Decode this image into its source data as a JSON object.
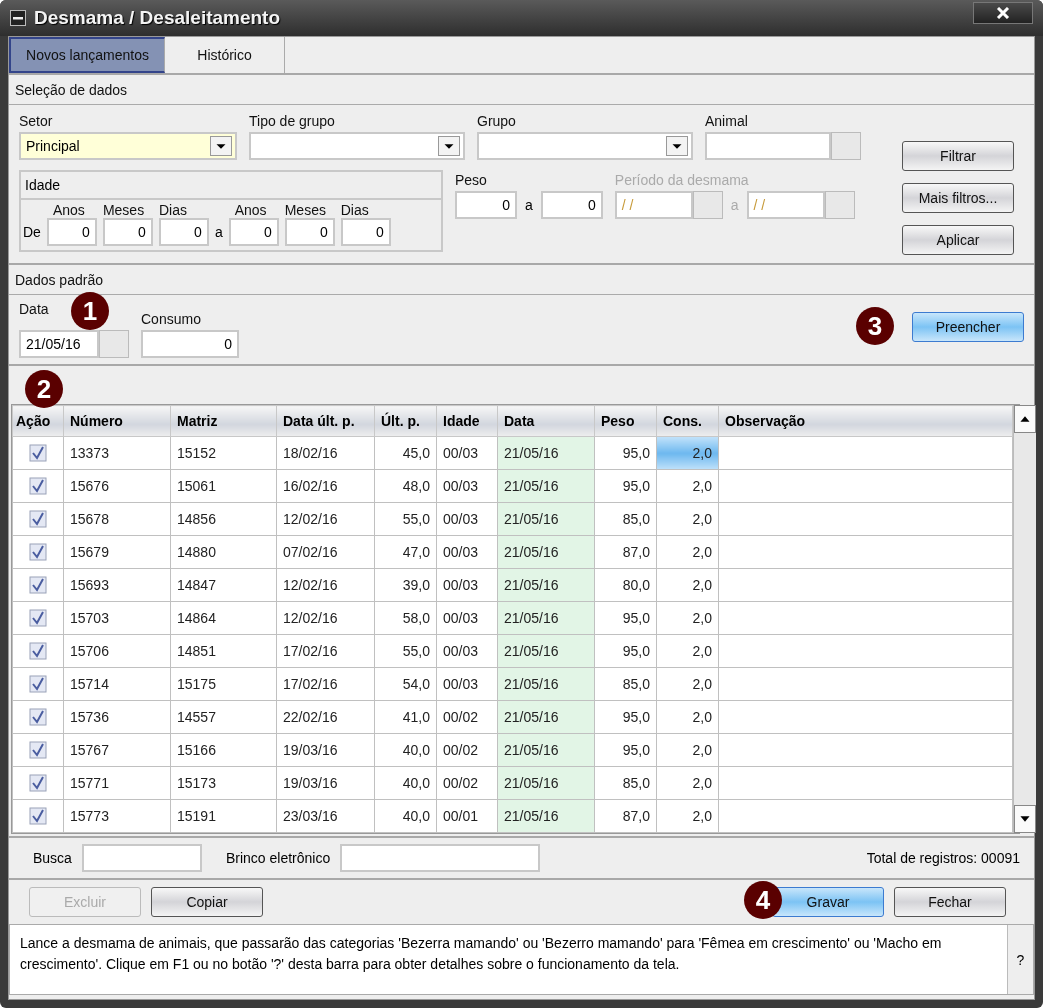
{
  "window": {
    "title": "Desmama / Desaleitamento"
  },
  "tabs": [
    {
      "label": "Novos lançamentos",
      "selected": true
    },
    {
      "label": "Histórico",
      "selected": false
    }
  ],
  "selection": {
    "title": "Seleção de dados",
    "setor": {
      "label": "Setor",
      "value": "Principal"
    },
    "tipo_grupo": {
      "label": "Tipo de grupo"
    },
    "grupo": {
      "label": "Grupo"
    },
    "animal": {
      "label": "Animal"
    },
    "idade": {
      "title": "Idade",
      "from_label": "De",
      "to_label": "a",
      "fields": [
        {
          "label": "Anos",
          "value": "0"
        },
        {
          "label": "Meses",
          "value": "0"
        },
        {
          "label": "Dias",
          "value": "0"
        },
        {
          "label": "Anos",
          "value": "0"
        },
        {
          "label": "Meses",
          "value": "0"
        },
        {
          "label": "Dias",
          "value": "0"
        }
      ]
    },
    "peso": {
      "label": "Peso",
      "from": "0",
      "to_label": "a",
      "to": "0"
    },
    "periodo": {
      "label": "Período da desmama",
      "disabled": true,
      "from": "/ /",
      "to_label": "a",
      "to": "/ /"
    },
    "buttons": [
      "Filtrar",
      "Mais filtros...",
      "Aplicar"
    ]
  },
  "defaults": {
    "title": "Dados padrão",
    "data": {
      "label": "Data",
      "value": "21/05/16"
    },
    "consumo": {
      "label": "Consumo",
      "value": "0"
    },
    "button": "Preencher",
    "markers": [
      "1",
      "3"
    ]
  },
  "table": {
    "marker": "2",
    "columns": [
      "Ação",
      "Número",
      "Matriz",
      "Data últ. p.",
      "Últ. p.",
      "Idade",
      "Data",
      "Peso",
      "Cons.",
      "Observação"
    ],
    "rows": [
      {
        "checked": true,
        "selected": true,
        "cells": [
          "",
          "13373",
          "15152",
          "18/02/16",
          "45,0",
          "00/03",
          "21/05/16",
          "95,0",
          "2,0",
          ""
        ]
      },
      {
        "checked": true,
        "selected": false,
        "cells": [
          "",
          "15676",
          "15061",
          "16/02/16",
          "48,0",
          "00/03",
          "21/05/16",
          "95,0",
          "2,0",
          ""
        ]
      },
      {
        "checked": true,
        "selected": false,
        "cells": [
          "",
          "15678",
          "14856",
          "12/02/16",
          "55,0",
          "00/03",
          "21/05/16",
          "85,0",
          "2,0",
          ""
        ]
      },
      {
        "checked": true,
        "selected": false,
        "cells": [
          "",
          "15679",
          "14880",
          "07/02/16",
          "47,0",
          "00/03",
          "21/05/16",
          "87,0",
          "2,0",
          ""
        ]
      },
      {
        "checked": true,
        "selected": false,
        "cells": [
          "",
          "15693",
          "14847",
          "12/02/16",
          "39,0",
          "00/03",
          "21/05/16",
          "80,0",
          "2,0",
          ""
        ]
      },
      {
        "checked": true,
        "selected": false,
        "cells": [
          "",
          "15703",
          "14864",
          "12/02/16",
          "58,0",
          "00/03",
          "21/05/16",
          "95,0",
          "2,0",
          ""
        ]
      },
      {
        "checked": true,
        "selected": false,
        "cells": [
          "",
          "15706",
          "14851",
          "17/02/16",
          "55,0",
          "00/03",
          "21/05/16",
          "95,0",
          "2,0",
          ""
        ]
      },
      {
        "checked": true,
        "selected": false,
        "cells": [
          "",
          "15714",
          "15175",
          "17/02/16",
          "54,0",
          "00/03",
          "21/05/16",
          "85,0",
          "2,0",
          ""
        ]
      },
      {
        "checked": true,
        "selected": false,
        "cells": [
          "",
          "15736",
          "14557",
          "22/02/16",
          "41,0",
          "00/02",
          "21/05/16",
          "95,0",
          "2,0",
          ""
        ]
      },
      {
        "checked": true,
        "selected": false,
        "cells": [
          "",
          "15767",
          "15166",
          "19/03/16",
          "40,0",
          "00/02",
          "21/05/16",
          "95,0",
          "2,0",
          ""
        ]
      },
      {
        "checked": true,
        "selected": false,
        "cells": [
          "",
          "15771",
          "15173",
          "19/03/16",
          "40,0",
          "00/02",
          "21/05/16",
          "85,0",
          "2,0",
          ""
        ]
      },
      {
        "checked": true,
        "selected": false,
        "cells": [
          "",
          "15773",
          "15191",
          "23/03/16",
          "40,0",
          "00/01",
          "21/05/16",
          "87,0",
          "2,0",
          ""
        ]
      }
    ]
  },
  "search": {
    "busca_label": "Busca",
    "brinco_label": "Brinco eletrônico",
    "total": "Total de registros: 00091"
  },
  "actions": [
    {
      "label": "Excluir",
      "disabled": true,
      "primary": false
    },
    {
      "label": "Copiar",
      "disabled": false,
      "primary": false
    },
    {
      "label": "Gravar",
      "disabled": false,
      "primary": true
    },
    {
      "label": "Fechar",
      "disabled": false,
      "primary": false
    }
  ],
  "actions_marker": "4",
  "help": {
    "text": "Lance a desmama de animais, que passarão das categorias 'Bezerra mamando' ou 'Bezerro mamando' para 'Fêmea em crescimento' ou 'Macho em crescimento'. Clique em F1 ou no botão '?' desta barra para obter detalhes sobre o funcionamento da tela.",
    "button": "?"
  }
}
